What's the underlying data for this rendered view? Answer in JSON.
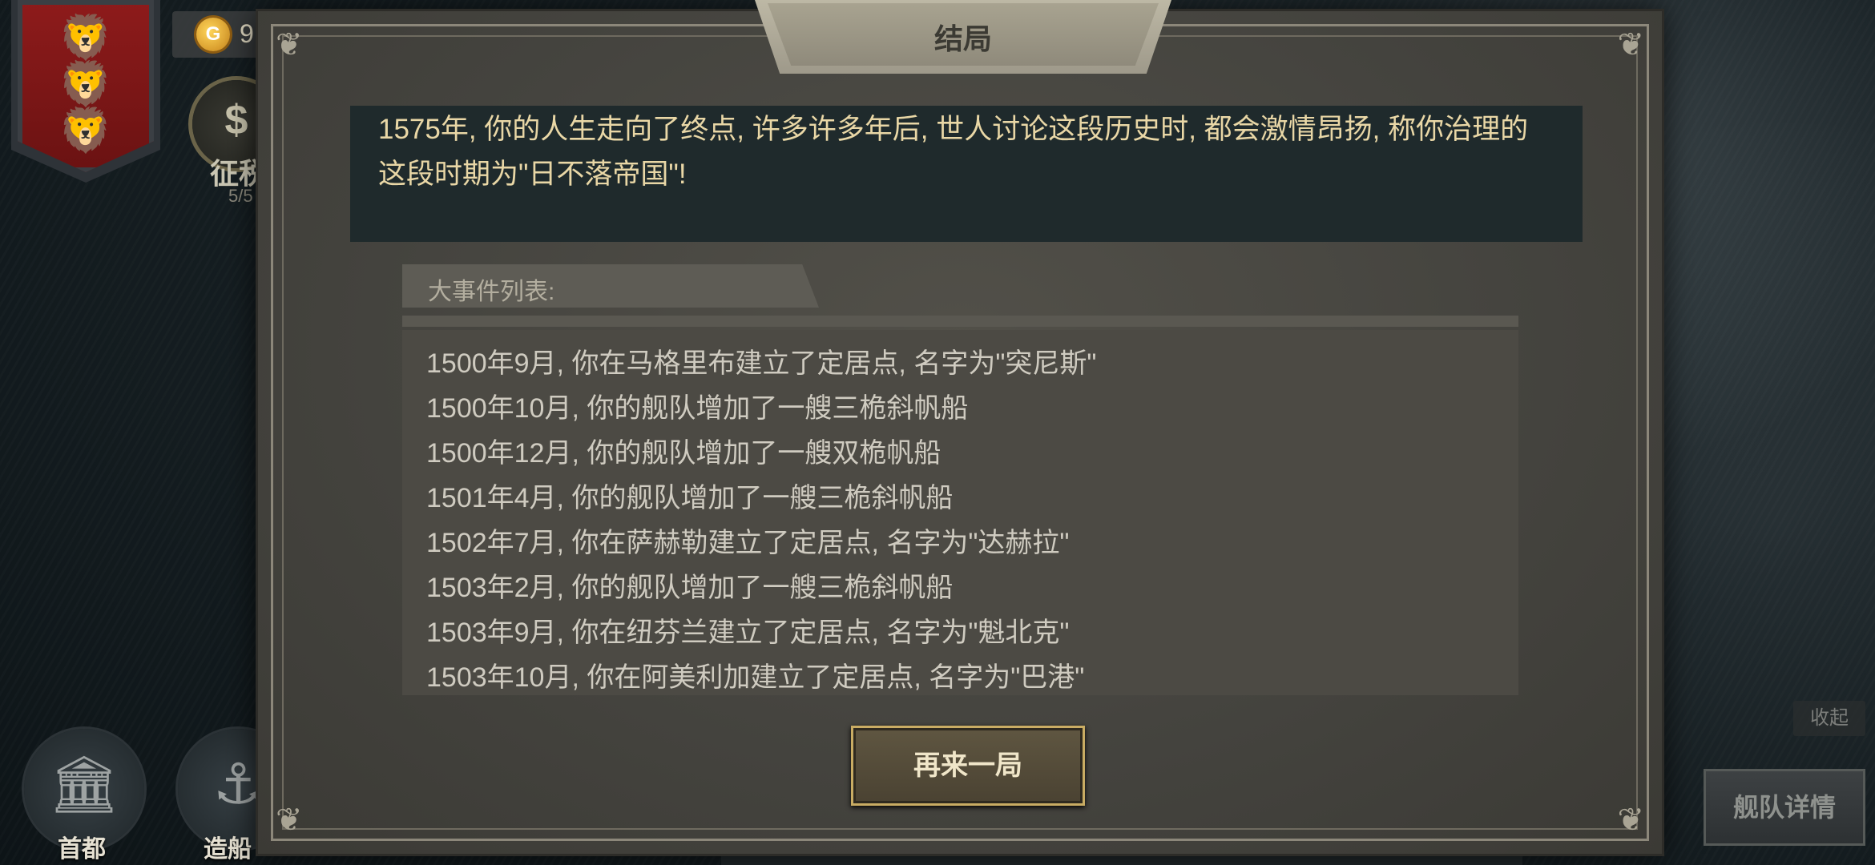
{
  "hud": {
    "gold_amount": "9",
    "tax_label": "征税",
    "tax_count": "5/5",
    "nav": [
      {
        "label": "首都"
      },
      {
        "label": "造船"
      }
    ],
    "collapse_label": "收起",
    "fleet_details_label": "舰队详情"
  },
  "modal": {
    "title": "结局",
    "summary": "1575年, 你的人生走向了终点, 许多许多年后, 世人讨论这段历史时, 都会激情昂扬, 称你治理的这段时期为\"日不落帝国\"!",
    "events_header": "大事件列表:",
    "events": [
      "1500年9月, 你在马格里布建立了定居点, 名字为\"突尼斯\"",
      "1500年10月, 你的舰队增加了一艘三桅斜帆船",
      "1500年12月, 你的舰队增加了一艘双桅帆船",
      "1501年4月, 你的舰队增加了一艘三桅斜帆船",
      "1502年7月, 你在萨赫勒建立了定居点, 名字为\"达赫拉\"",
      "1503年2月, 你的舰队增加了一艘三桅斜帆船",
      "1503年9月, 你在纽芬兰建立了定居点, 名字为\"魁北克\"",
      "1503年10月, 你在阿美利加建立了定居点, 名字为\"巴港\""
    ],
    "replay_label": "再来一局"
  },
  "colors": {
    "banner_red": "#8e1b1b",
    "lion_gold": "#d9a93a",
    "summary_text": "#e9d7a6",
    "button_border": "#c9ac63"
  }
}
